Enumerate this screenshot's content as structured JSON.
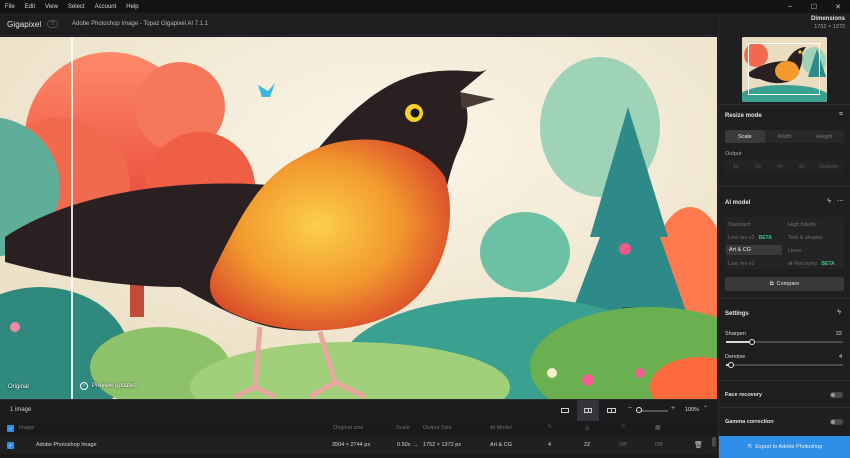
{
  "menu": [
    "File",
    "Edit",
    "View",
    "Select",
    "Account",
    "Help"
  ],
  "window_controls": [
    "–",
    "☐",
    "✕"
  ],
  "app": {
    "brand": "Gigapixel",
    "badge": "7",
    "title": "Adobe Photoshop Image - Topaz Gigapixel AI 7.1.1"
  },
  "preview": {
    "label_original": "Original",
    "label_updated": "Preview updated"
  },
  "panel": {
    "dimensions_title": "Dimensions",
    "dimensions_value": "1752 × 1372",
    "resize": {
      "title": "Resize mode",
      "modes": [
        "Scale",
        "Width",
        "Height"
      ],
      "active_mode": "Scale",
      "output_label": "Output",
      "output_options": [
        "1x",
        "2x",
        "4x",
        "6x",
        "Custom"
      ]
    },
    "ai_model": {
      "title": "AI model",
      "models": {
        "standard": "Standard",
        "high_fidelity": "High fidelity",
        "low_res_v2": "Low res v2",
        "text_shapes": "Text & shapes",
        "art_cg": "Art & CG",
        "lines": "Lines",
        "low_res_v1": "Low res v1",
        "recovery": "Recovery"
      },
      "beta_label": "BETA",
      "selected": "Art & CG",
      "compare_label": "Compare"
    },
    "settings": {
      "title": "Settings",
      "sharpen_label": "Sharpen",
      "sharpen_value": "22",
      "sharpen_fraction": 0.22,
      "denoise_label": "Denoise",
      "denoise_value": "4",
      "denoise_fraction": 0.04
    },
    "face_recovery_label": "Face recovery",
    "gamma_label": "Gamma correction",
    "export_label": "Export to Adobe Photoshop"
  },
  "toolbar": {
    "image_count": "1 image",
    "zoom_value": "100%",
    "zoom_fraction": 0.1
  },
  "table": {
    "headers": {
      "image": "Image",
      "original_size": "Original size",
      "scale": "Scale",
      "output_size": "Output Size",
      "ai_model": "AI Model"
    },
    "row": {
      "image": "Adobe Photoshop Image",
      "original_size": "3504 × 2744 px",
      "scale": "0.50x",
      "arrow": "→",
      "output_size": "1752 × 1372 px",
      "ai_model": "Art & CG",
      "col_a": "4",
      "col_b": "22",
      "col_c": "Off",
      "col_d": "Off"
    }
  },
  "colors": {
    "accent": "#2f8ee8",
    "beta": "#34c77b",
    "panel": "#1f1f21"
  }
}
